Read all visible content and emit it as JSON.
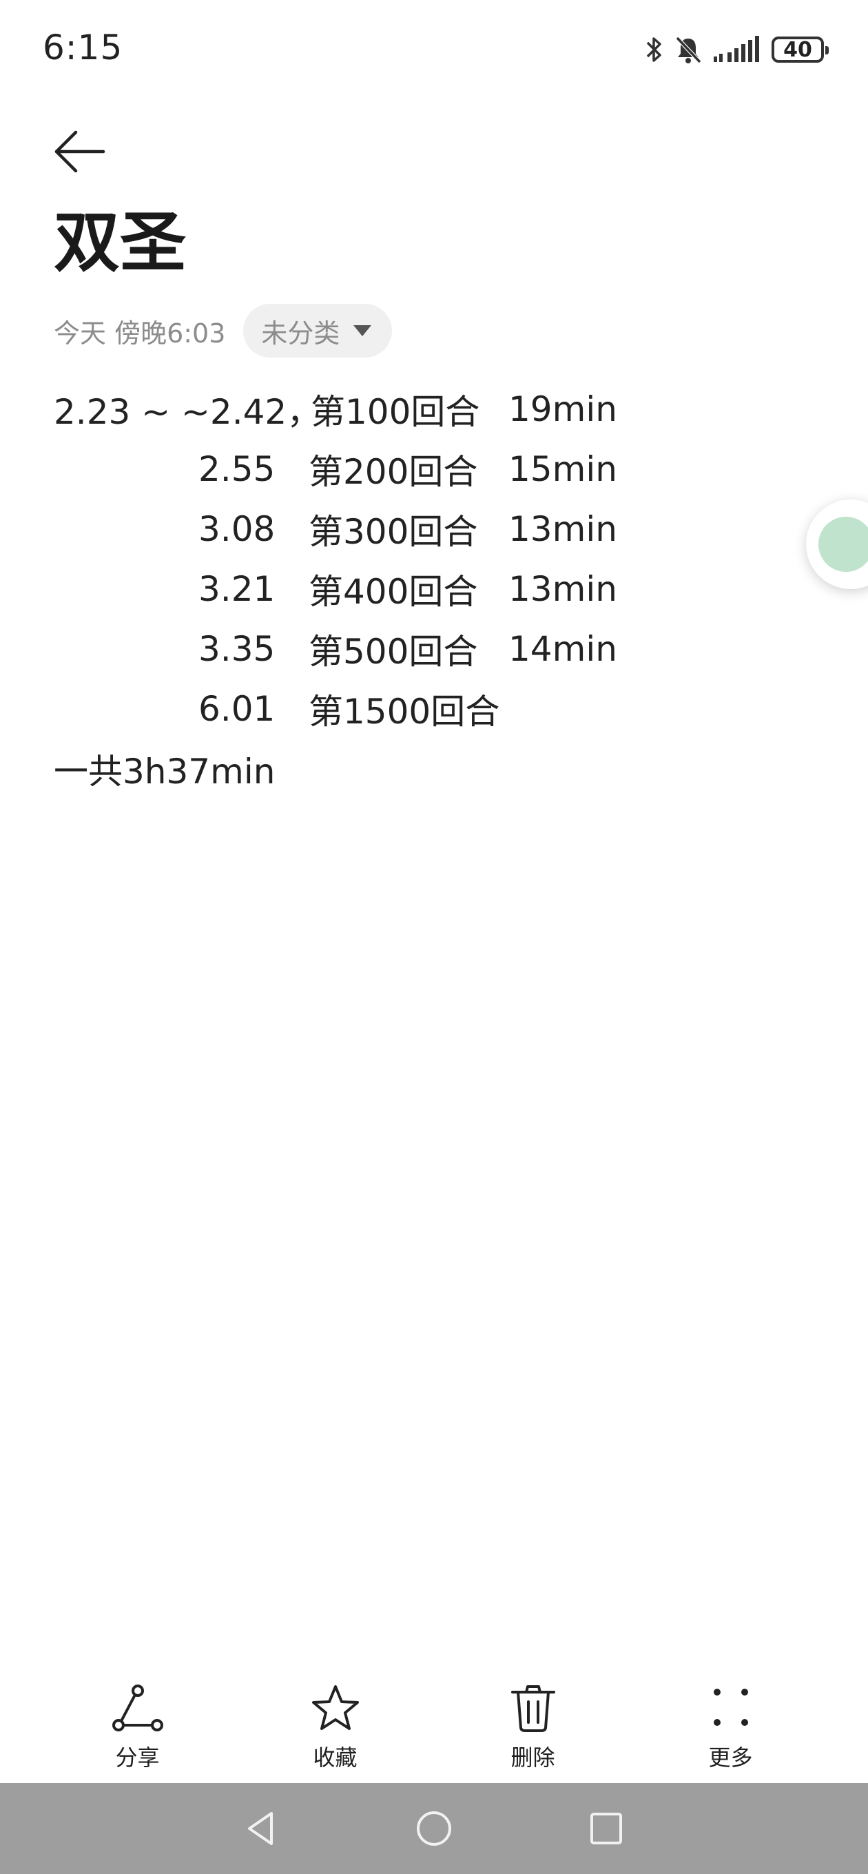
{
  "status_bar": {
    "time": "6:15",
    "battery_level": "40",
    "icons": [
      "bluetooth-icon",
      "mute-bell-icon",
      "signal-icon",
      "battery-icon"
    ]
  },
  "header": {
    "back_icon": "arrow-left-icon",
    "title": "双圣",
    "date": "今天 傍晚6:03",
    "category": "未分类"
  },
  "note": {
    "first_line": [
      "2.23 ~  ~2.42，",
      "第100回合",
      "19min"
    ],
    "rows": [
      [
        "2.55",
        "第200回合",
        "15min"
      ],
      [
        "3.08",
        "第300回合",
        "13min"
      ],
      [
        "3.21",
        "第400回合",
        "13min"
      ],
      [
        "3.35",
        "第500回合",
        "14min"
      ],
      [
        "6.01",
        "第1500回合",
        ""
      ]
    ],
    "summary": "一共3h37min"
  },
  "toolbar": {
    "share_label": "分享",
    "favorite_label": "收藏",
    "delete_label": "删除",
    "more_label": "更多"
  },
  "nav": {
    "icons": [
      "back-triangle-icon",
      "home-circle-icon",
      "recents-square-icon"
    ]
  },
  "colors": {
    "text_primary": "#1f1f1f",
    "text_secondary": "#8c8c8c",
    "chip_bg": "#f0f0f0",
    "nav_bar_bg": "#9e9e9e",
    "floating_handle": "#bfe3cc"
  }
}
